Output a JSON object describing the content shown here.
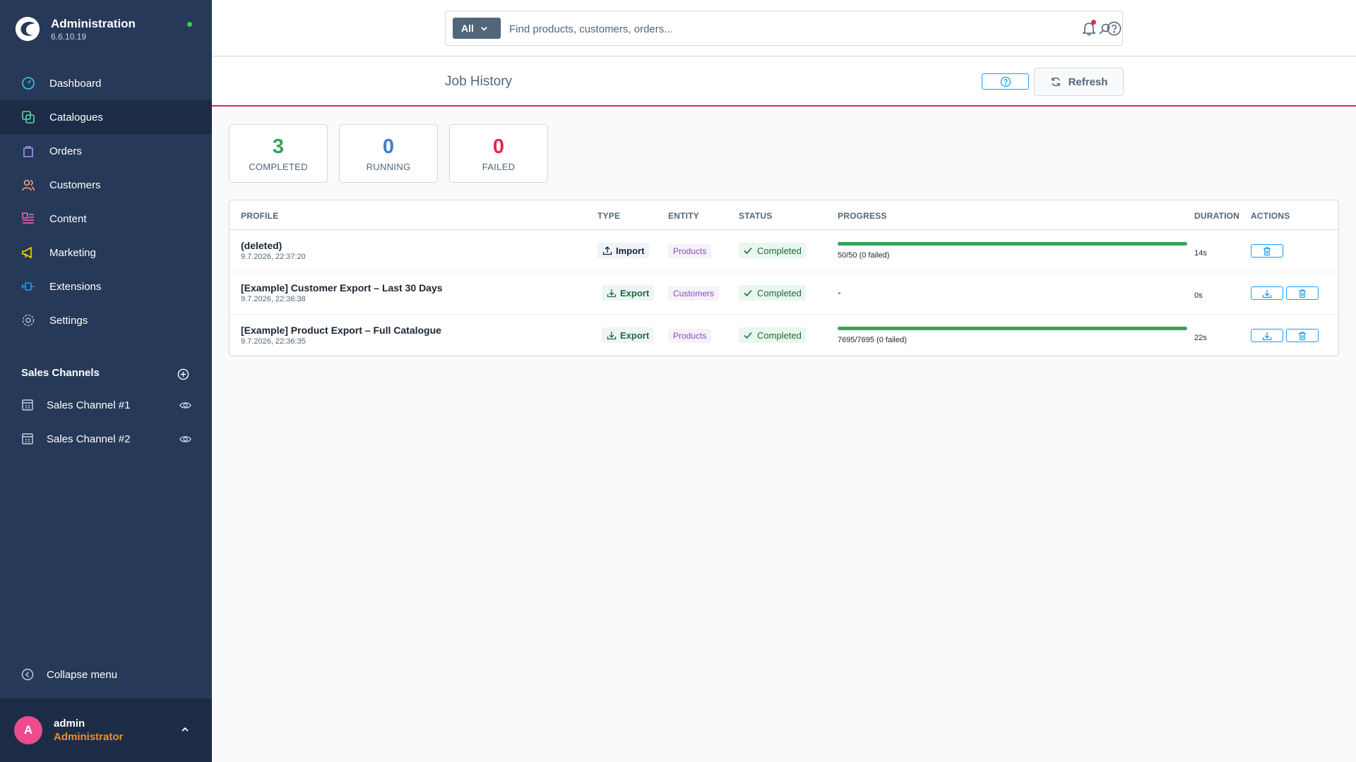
{
  "app": {
    "title": "Administration",
    "version": "6.6.10.19"
  },
  "nav": [
    {
      "label": "Dashboard",
      "icon": "dashboard-icon"
    },
    {
      "label": "Catalogues",
      "icon": "catalogues-icon"
    },
    {
      "label": "Orders",
      "icon": "orders-icon"
    },
    {
      "label": "Customers",
      "icon": "customers-icon"
    },
    {
      "label": "Content",
      "icon": "content-icon"
    },
    {
      "label": "Marketing",
      "icon": "marketing-icon"
    },
    {
      "label": "Extensions",
      "icon": "extensions-icon"
    },
    {
      "label": "Settings",
      "icon": "settings-icon"
    }
  ],
  "sales_channels": {
    "title": "Sales Channels",
    "items": [
      {
        "label": "Sales Channel #1"
      },
      {
        "label": "Sales Channel #2"
      }
    ]
  },
  "collapse_label": "Collapse menu",
  "user": {
    "initial": "A",
    "name": "admin",
    "role": "Administrator"
  },
  "search": {
    "filter_label": "All",
    "placeholder": "Find products, customers, orders..."
  },
  "page": {
    "title": "Job History",
    "refresh_label": "Refresh"
  },
  "stats": [
    {
      "value": "3",
      "label": "COMPLETED",
      "color": "#37a25a"
    },
    {
      "value": "0",
      "label": "RUNNING",
      "color": "#3d7cd4"
    },
    {
      "value": "0",
      "label": "FAILED",
      "color": "#de294c"
    }
  ],
  "table": {
    "headers": {
      "profile": "PROFILE",
      "type": "TYPE",
      "entity": "ENTITY",
      "status": "STATUS",
      "progress": "PROGRESS",
      "duration": "DURATION",
      "actions": "ACTIONS"
    },
    "rows": [
      {
        "profile": "(deleted)",
        "date": "9.7.2026, 22:37:20",
        "type": "Import",
        "entity": "Products",
        "status": "Completed",
        "progress_fraction": 1.0,
        "progress_text": "50/50 (0 failed)",
        "duration": "14s"
      },
      {
        "profile": "[Example] Customer Export – Last 30 Days",
        "date": "9.7.2026, 22:36:38",
        "type": "Export",
        "entity": "Customers",
        "status": "Completed",
        "progress_text": "-",
        "duration": "0s"
      },
      {
        "profile": "[Example] Product Export – Full Catalogue",
        "date": "9.7.2026, 22:36:35",
        "type": "Export",
        "entity": "Products",
        "status": "Completed",
        "progress_fraction": 1.0,
        "progress_text": "7695/7695 (0 failed)",
        "duration": "22s"
      }
    ]
  },
  "colors": {
    "sidebar": "#263958",
    "accent_red": "#de294c",
    "success": "#37a25a",
    "link_blue": "#189eff"
  }
}
